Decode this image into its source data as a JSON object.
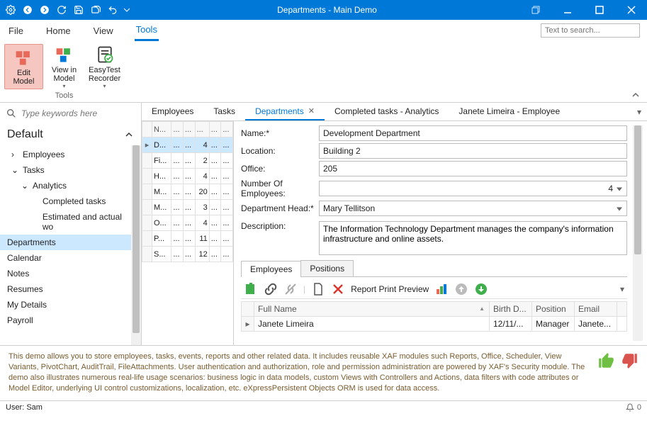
{
  "window": {
    "title": "Departments - Main Demo"
  },
  "ribbon": {
    "tabs": [
      "File",
      "Home",
      "View",
      "Tools"
    ],
    "active_tab": "Tools",
    "search_placeholder": "Text to search...",
    "group_label": "Tools",
    "items": [
      {
        "label": "Edit Model"
      },
      {
        "label": "View in Model"
      },
      {
        "label": "EasyTest Recorder"
      }
    ]
  },
  "sidebar": {
    "search_placeholder": "Type keywords here",
    "header": "Default",
    "items": {
      "employees": "Employees",
      "tasks": "Tasks",
      "analytics": "Analytics",
      "completed": "Completed tasks",
      "estimated": "Estimated and actual wo",
      "departments": "Departments",
      "calendar": "Calendar",
      "notes": "Notes",
      "resumes": "Resumes",
      "mydetails": "My Details",
      "payroll": "Payroll"
    }
  },
  "doc_tabs": {
    "t0": "Employees",
    "t1": "Tasks",
    "t2": "Departments",
    "t3": "Completed tasks - Analytics",
    "t4": "Janete Limeira - Employee"
  },
  "dept_grid": {
    "headers": [
      "N...",
      "...",
      "...",
      "...",
      "...",
      "..."
    ],
    "rows": [
      {
        "c0": "D...",
        "c1": "...",
        "c2": "...",
        "c3": "4",
        "c4": "...",
        "c5": "..."
      },
      {
        "c0": "Fi...",
        "c1": "...",
        "c2": "...",
        "c3": "2",
        "c4": "...",
        "c5": "..."
      },
      {
        "c0": "H...",
        "c1": "...",
        "c2": "...",
        "c3": "4",
        "c4": "...",
        "c5": "..."
      },
      {
        "c0": "M...",
        "c1": "...",
        "c2": "...",
        "c3": "20",
        "c4": "...",
        "c5": "..."
      },
      {
        "c0": "M...",
        "c1": "...",
        "c2": "...",
        "c3": "3",
        "c4": "...",
        "c5": "..."
      },
      {
        "c0": "O...",
        "c1": "...",
        "c2": "...",
        "c3": "4",
        "c4": "...",
        "c5": "..."
      },
      {
        "c0": "P...",
        "c1": "...",
        "c2": "...",
        "c3": "11",
        "c4": "...",
        "c5": "..."
      },
      {
        "c0": "S...",
        "c1": "...",
        "c2": "...",
        "c3": "12",
        "c4": "...",
        "c5": "..."
      }
    ]
  },
  "form": {
    "labels": {
      "name": "Name:*",
      "location": "Location:",
      "office": "Office:",
      "num_employees": "Number Of Employees:",
      "head": "Department Head:*",
      "description": "Description:"
    },
    "values": {
      "name": "Development Department",
      "location": "Building 2",
      "office": "205",
      "num_employees": "4",
      "head": "Mary Tellitson",
      "description": "The Information Technology Department manages the company's information infrastructure and online assets."
    }
  },
  "sub": {
    "tabs": {
      "employees": "Employees",
      "positions": "Positions"
    },
    "toolbar": {
      "report": "Report Print Preview"
    },
    "columns": {
      "fullname": "Full Name",
      "birth": "Birth D...",
      "position": "Position",
      "email": "Email"
    },
    "rows": [
      {
        "fullname": "Janete Limeira",
        "birth": "12/11/...",
        "position": "Manager",
        "email": "Janete..."
      }
    ]
  },
  "footer": {
    "text": "This demo allows you to store employees, tasks, events, reports and other related data. It includes reusable XAF modules such Reports, Office, Scheduler, View Variants, PivotChart, AuditTrail, FileAttachments. User authentication and authorization, role and permission administration are powered by XAF's Security module. The demo also illustrates numerous real-life usage scenarios: business logic in data models, custom Views with Controllers and Actions, data filters with code attributes or Model Editor, underlying UI control customizations, localization, etc. eXpressPersistent Objects ORM is used for data access."
  },
  "status": {
    "user": "User: Sam",
    "notif_count": "0"
  }
}
